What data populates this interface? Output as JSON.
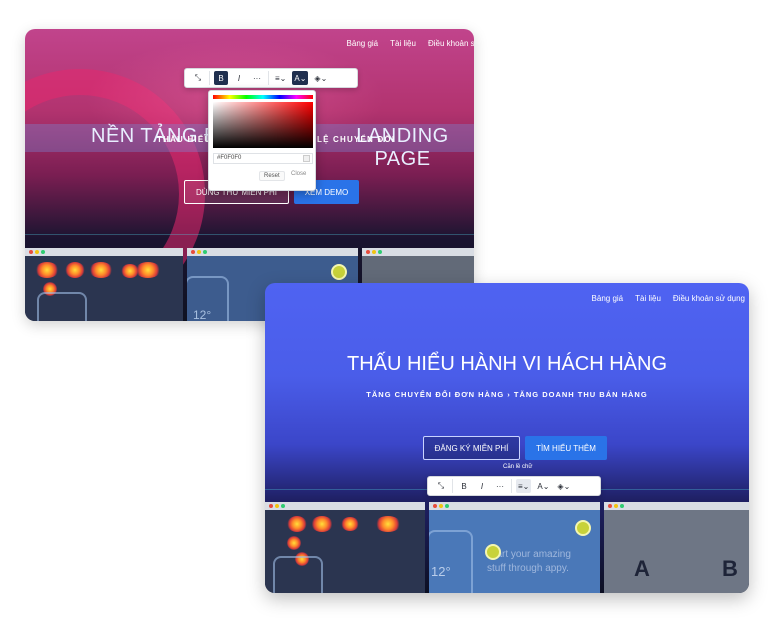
{
  "back_window": {
    "nav": [
      "Bảng giá",
      "Tài liệu",
      "Điều khoản sử"
    ],
    "hero_title_left": "NỀN TẢNG Đ",
    "hero_title_right": "LANDING PAGE",
    "hero_subtitle_left": "THẤU HIỂU",
    "hero_subtitle_right": "LỆ CHUYỂN ĐỔI",
    "btn_free": "DÙNG THỬ MIỄN PHÍ",
    "btn_demo": "XEM DEMO",
    "color_picker": {
      "hex_value": "#F0F0F0",
      "reset": "Reset",
      "close": "Close"
    },
    "thumb_text": "12°"
  },
  "front_window": {
    "nav": [
      "Bảng giá",
      "Tài liệu",
      "Điều khoản sử dụng"
    ],
    "hero_title": "THẤU HIỂU HÀNH VI HÁCH HÀNG",
    "hero_subtitle": "TĂNG CHUYỂN ĐỔI ĐƠN HÀNG  ›  TĂNG DOANH THU BÁN HÀNG",
    "btn_signup": "ĐĂNG KÝ MIỄN PHÍ",
    "btn_learn": "TÌM HIỂU THÊM",
    "tooltip": "Căn lề chữ",
    "thumb_text": "12°",
    "thumb_caption_1": "Start your amazing",
    "thumb_caption_2": "stuff through appy.",
    "ab_a": "A",
    "ab_b": "B"
  },
  "toolbar": {
    "bold": "B",
    "italic": "I",
    "more": "···",
    "align": "≡",
    "font_color": "A",
    "fill": "◈",
    "chevron": "⌄"
  },
  "colors": {
    "back_gradient_top": "#c1448c",
    "front_gradient_top": "#4f63f2",
    "accent_button": "#2a73e8",
    "toolbar_active": "#20304f"
  }
}
